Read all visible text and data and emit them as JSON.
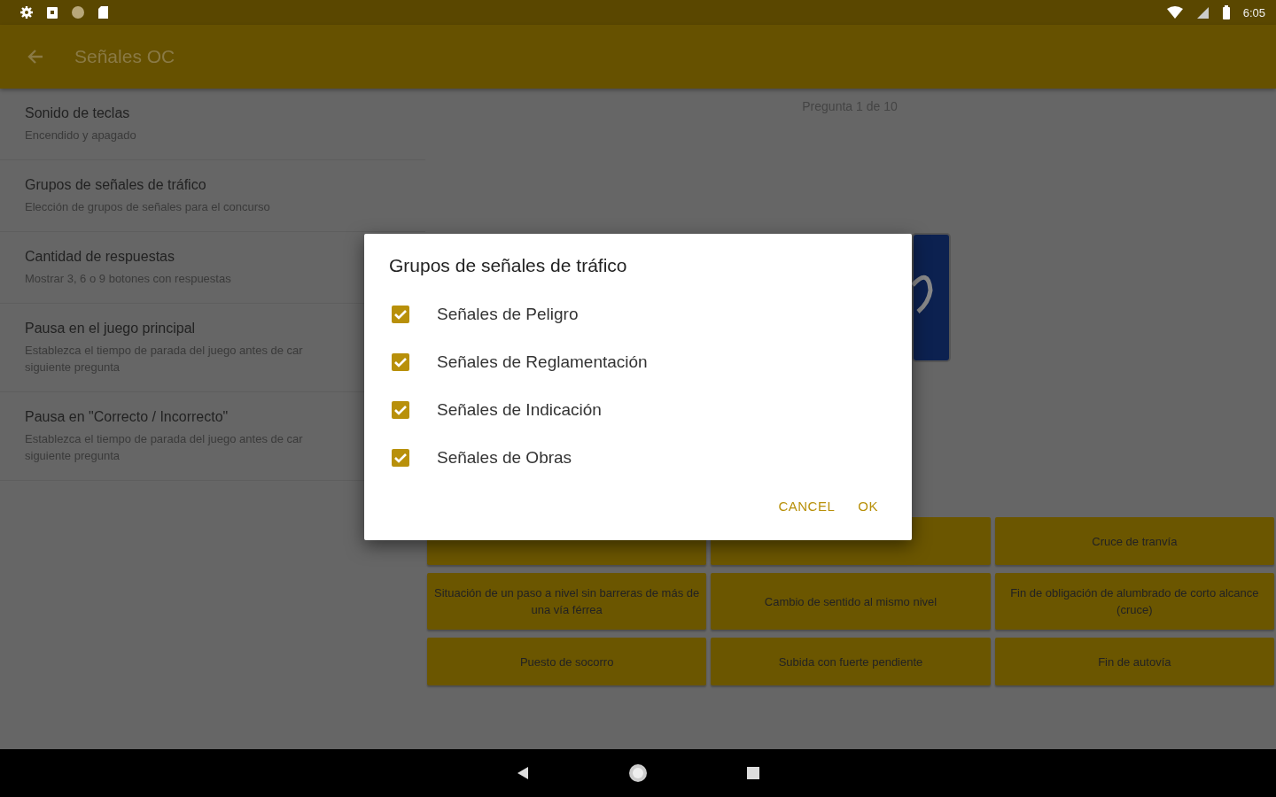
{
  "status_bar": {
    "time": "6:05"
  },
  "toolbar": {
    "title": "Señales OC"
  },
  "preferences": [
    {
      "title": "Sonido de teclas",
      "summary": "Encendido y apagado"
    },
    {
      "title": "Grupos de señales de tráfico",
      "summary": "Elección de grupos de señales para el concurso"
    },
    {
      "title": "Cantidad de respuestas",
      "summary": "Mostrar 3, 6 o 9 botones con respuestas"
    },
    {
      "title": "Pausa en el juego principal",
      "summary": "Establezca el tiempo de parada del juego antes de car\nsiguiente pregunta"
    },
    {
      "title": "Pausa en \"Correcto / Incorrecto\"",
      "summary": "Establezca el tiempo de parada del juego antes de car\nsiguiente pregunta"
    }
  ],
  "quiz": {
    "progress": "Pregunta 1 de 10",
    "answers": [
      {
        "kind": "covered"
      },
      {
        "kind": "covered"
      },
      {
        "kind": "answer",
        "label": "Cruce de tranvía"
      },
      {
        "kind": "answer",
        "label": "Situación de un paso a nivel sin barreras de más de una vía férrea"
      },
      {
        "kind": "answer",
        "label": "Cambio de sentido al mismo nivel"
      },
      {
        "kind": "answer",
        "label": "Fin de obligación de alumbrado de corto alcance (cruce)"
      },
      {
        "kind": "answer",
        "label": "Puesto de socorro"
      },
      {
        "kind": "answer",
        "label": "Subida con fuerte pendiente"
      },
      {
        "kind": "answer",
        "label": "Fin de autovía"
      }
    ]
  },
  "dialog": {
    "title": "Grupos de señales de tráfico",
    "options": [
      {
        "label": "Señales de Peligro",
        "checked": true
      },
      {
        "label": "Señales de Reglamentación",
        "checked": true
      },
      {
        "label": "Señales de Indicación",
        "checked": true
      },
      {
        "label": "Señales de Obras",
        "checked": true
      }
    ],
    "buttons": [
      "CANCEL",
      "OK"
    ]
  }
}
